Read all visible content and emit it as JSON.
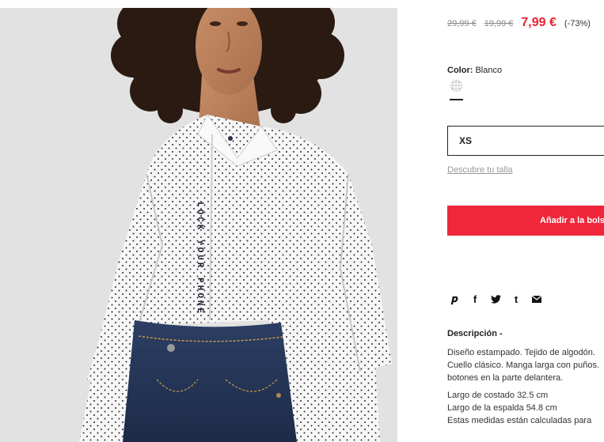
{
  "product": {
    "prices": {
      "original_1": "29,99 €",
      "original_2": "19,99 €",
      "sale": "7,99 €",
      "discount": "(-73%)"
    },
    "color": {
      "label": "Color:",
      "value": "Blanco"
    },
    "shirt_print": "LOCK YOUR PHONE",
    "size": {
      "selected": "XS",
      "size_guide_link": "Descubre tu talla"
    },
    "add_to_bag": "Añadir a la bolsa",
    "share_icons": [
      "pinterest-icon",
      "facebook-icon",
      "twitter-icon",
      "tumblr-icon",
      "mail-icon"
    ],
    "description": {
      "title": "Descripción -",
      "line1": "Diseño estampado. Tejido de algodón.",
      "line2": "Cuello clásico. Manga larga con puños.",
      "line3": "botones en la parte delantera.",
      "line4": "Largo de costado 32.5 cm",
      "line5": "Largo de la espalda 54.8 cm",
      "line6": "Estas medidas están calculadas para"
    }
  },
  "colors": {
    "accent_red": "#e8222e",
    "button_red": "#f0273a",
    "text_dark": "#222222",
    "muted": "#999999"
  }
}
